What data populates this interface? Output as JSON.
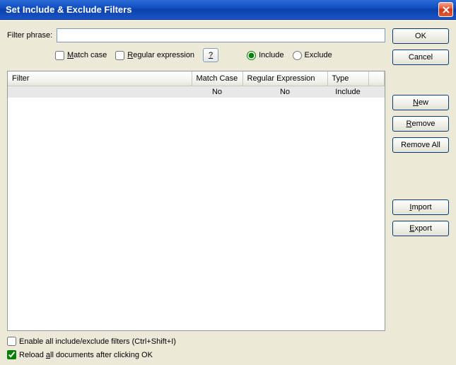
{
  "title": "Set Include & Exclude Filters",
  "labels": {
    "filter_phrase": "Filter phrase:",
    "match_case_pre": "M",
    "match_case_post": "atch case",
    "regex_pre": "R",
    "regex_post": "egular expression",
    "help": "?",
    "include": "Include",
    "exclude": "Exclude",
    "enable_all": "Enable all include/exclude filters (Ctrl+Shift+I)",
    "reload_pre": "Reload ",
    "reload_u": "a",
    "reload_post": "ll documents after clicking OK"
  },
  "input": {
    "phrase_value": ""
  },
  "options": {
    "match_case": false,
    "regex": false,
    "mode": "include",
    "enable_all": false,
    "reload_all": true
  },
  "table": {
    "headers": {
      "filter": "Filter",
      "match_case": "Match Case",
      "regex": "Regular Expression",
      "type": "Type"
    },
    "rows": [
      {
        "filter": "",
        "match_case": "No",
        "regex": "No",
        "type": "Include"
      }
    ]
  },
  "buttons": {
    "ok": "OK",
    "cancel": "Cancel",
    "new_pre": "N",
    "new_post": "ew",
    "remove_pre": "R",
    "remove_post": "emove",
    "remove_all": "Remove All",
    "import_pre": "I",
    "import_post": "mport",
    "export_pre": "E",
    "export_post": "xport"
  }
}
